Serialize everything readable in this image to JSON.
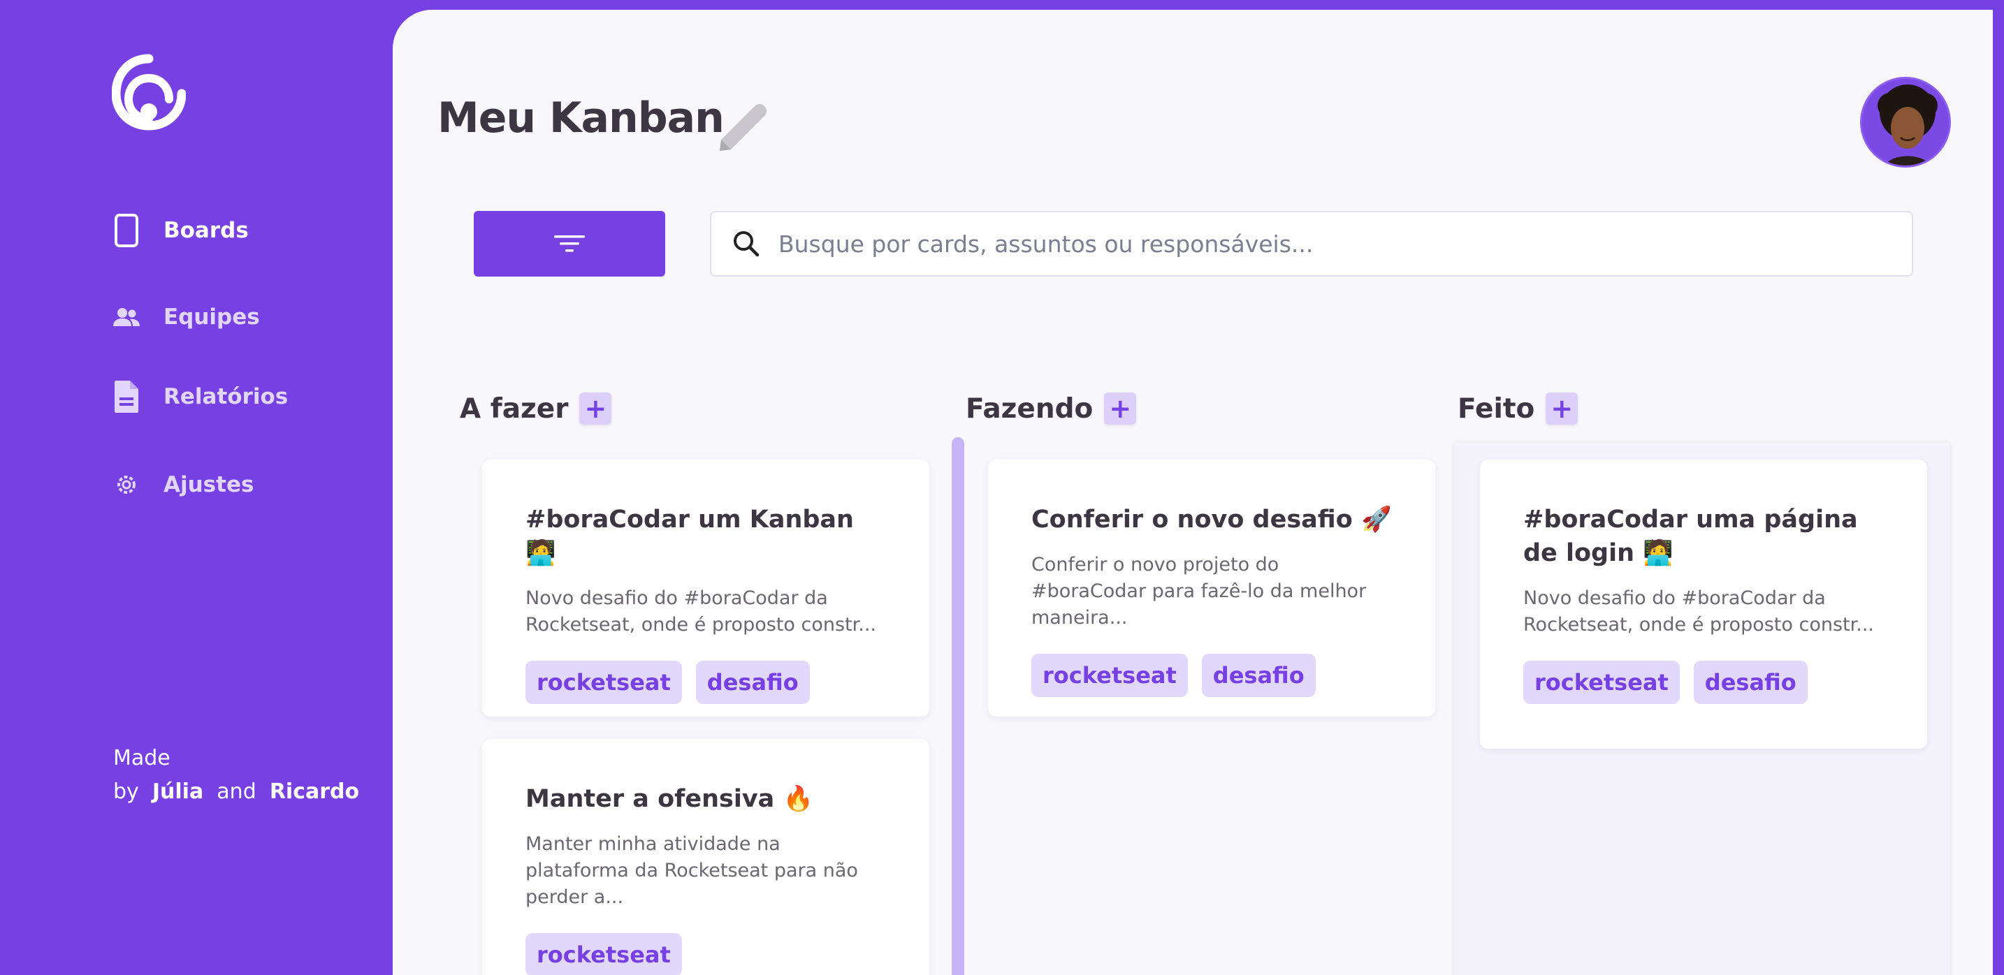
{
  "sidebar": {
    "items": [
      {
        "label": "Boards",
        "icon": "board-icon"
      },
      {
        "label": "Equipes",
        "icon": "team-icon"
      },
      {
        "label": "Relatórios",
        "icon": "document-icon"
      },
      {
        "label": "Ajustes",
        "icon": "gear-icon"
      }
    ],
    "credit": {
      "made": "Made",
      "by": "by",
      "author1": "Júlia",
      "and": "and",
      "author2": "Ricardo"
    }
  },
  "header": {
    "title": "Meu Kanban"
  },
  "search": {
    "placeholder": "Busque por cards, assuntos ou responsáveis..."
  },
  "columns": [
    {
      "title": "A fazer",
      "cards": [
        {
          "title": "#boraCodar um Kanban 🧑‍💻",
          "desc": "Novo desafio do #boraCodar da Rocketseat, onde é proposto constr...",
          "tags": [
            "rocketseat",
            "desafio"
          ]
        },
        {
          "title": "Manter a ofensiva 🔥",
          "desc": "Manter minha atividade na plataforma da Rocketseat para não perder a...",
          "tags": [
            "rocketseat"
          ]
        }
      ]
    },
    {
      "title": "Fazendo",
      "cards": [
        {
          "title": "Conferir o novo desafio 🚀",
          "desc": "Conferir o novo projeto do #boraCodar para fazê-lo da melhor maneira...",
          "tags": [
            "rocketseat",
            "desafio"
          ]
        }
      ]
    },
    {
      "title": "Feito",
      "cards": [
        {
          "title": "#boraCodar uma página de login 🧑‍💻",
          "desc": "Novo desafio do #boraCodar da Rocketseat, onde é proposto constr...",
          "tags": [
            "rocketseat",
            "desafio"
          ]
        }
      ]
    }
  ],
  "add_label": "+",
  "colors": {
    "accent": "#7640e3",
    "tag_bg": "#e2d8fb",
    "main_bg": "#f8f7fc"
  }
}
